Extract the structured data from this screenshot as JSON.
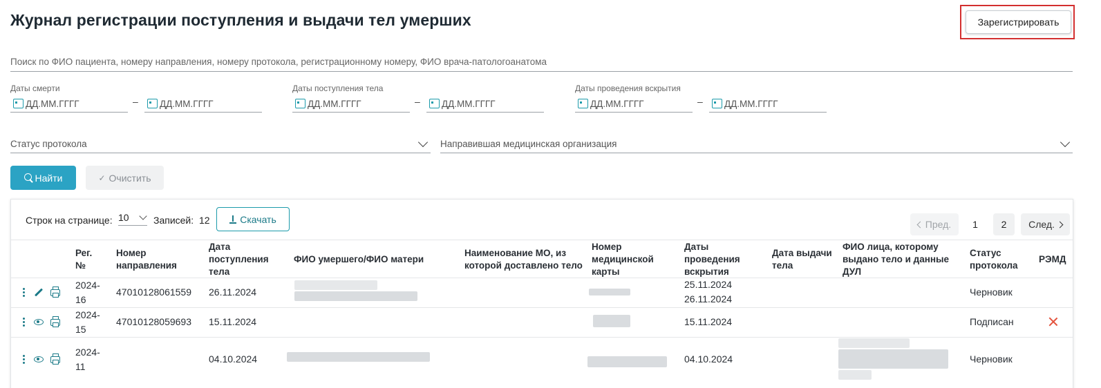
{
  "page": {
    "title": "Журнал регистрации поступления и выдачи тел умерших"
  },
  "header": {
    "register_label": "Зарегистрировать"
  },
  "filters": {
    "search_placeholder": "Поиск по ФИО пациента, номеру направления, номеру протокола, регистрационному номеру, ФИО врача-патологоанатома",
    "death_dates_label": "Даты смерти",
    "admission_dates_label": "Даты поступления тела",
    "autopsy_dates_label": "Даты проведения вскрытия",
    "date_placeholder": "ДД.ММ.ГГГГ",
    "dash": "–",
    "protocol_status_label": "Статус протокола",
    "referring_org_label": "Направившая медицинская организация",
    "find_label": "Найти",
    "clear_label": "Очистить"
  },
  "table_controls": {
    "rows_per_page_label": "Строк на странице:",
    "rows_per_page_value": "10",
    "records_label": "Записей:",
    "records_count": "12",
    "download_label": "Скачать"
  },
  "pagination": {
    "prev_label": "Пред.",
    "pages": [
      "1",
      "2"
    ],
    "next_label": "След."
  },
  "columns": {
    "reg_no": "Рег. №",
    "referral_no": "Номер направления",
    "admission_date": "Дата поступления тела",
    "deceased_name": "ФИО умершего/ФИО матери",
    "source_org": "Наименование МО, из которой доставлено тело",
    "med_card_no": "Номер медицинской карты",
    "autopsy_dates": "Даты проведения вскрытия",
    "release_date": "Дата выдачи тела",
    "recipient": "ФИО лица, которому выдано тело и данные ДУЛ",
    "status": "Статус протокола",
    "remd": "РЭМД"
  },
  "rows": [
    {
      "reg_no": "2024-16",
      "referral_no": "47010128061559",
      "admission_date": "26.11.2024",
      "autopsy_dates": [
        "25.11.2024",
        "26.11.2024"
      ],
      "status": "Черновик",
      "action_icon": "pencil-icon",
      "remd": ""
    },
    {
      "reg_no": "2024-15",
      "referral_no": "47010128059693",
      "admission_date": "15.11.2024",
      "autopsy_dates": [
        "15.11.2024"
      ],
      "status": "Подписан",
      "action_icon": "eye-icon",
      "remd": "x-icon"
    },
    {
      "reg_no": "2024-11",
      "referral_no": "",
      "admission_date": "04.10.2024",
      "autopsy_dates": [
        "04.10.2024"
      ],
      "status": "Черновик",
      "action_icon": "eye-icon",
      "remd": ""
    }
  ],
  "colors": {
    "accent": "#2ba3c4",
    "teal_icon": "#1b7a88",
    "highlight": "#d32f2f",
    "remd_error": "#e4543e"
  }
}
